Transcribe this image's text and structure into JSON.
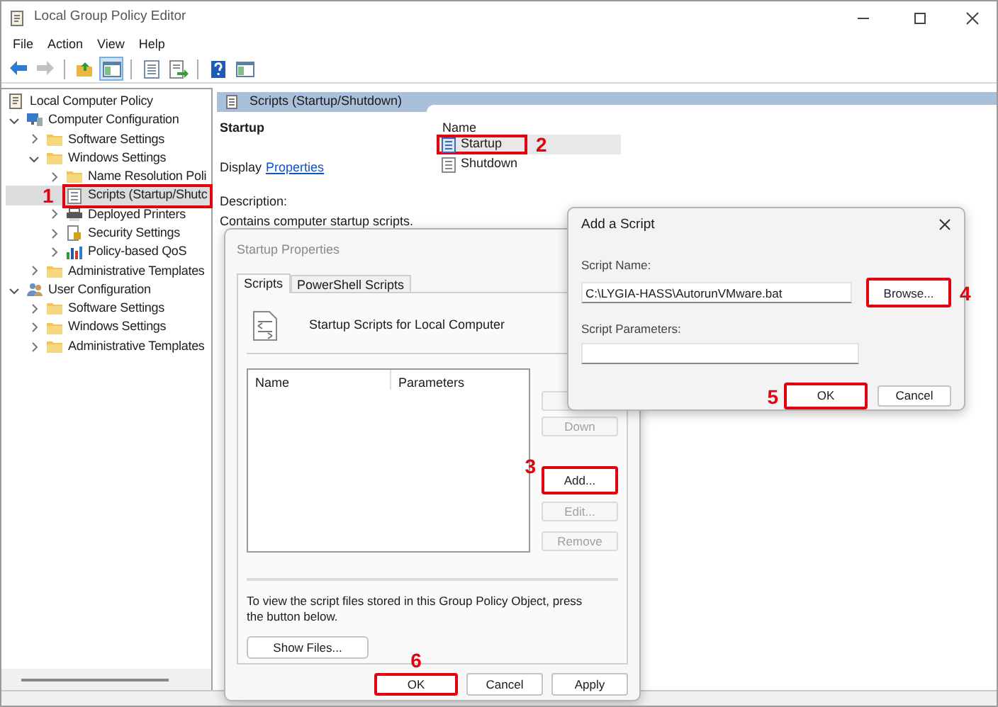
{
  "window": {
    "title": "Local Group Policy Editor"
  },
  "menu": [
    "File",
    "Action",
    "View",
    "Help"
  ],
  "toolbar": [
    {
      "kind": "back",
      "disabled": false,
      "selected": false
    },
    {
      "kind": "forward",
      "disabled": true,
      "selected": false
    },
    {
      "kind": "separator"
    },
    {
      "kind": "folder-up",
      "disabled": false,
      "selected": false
    },
    {
      "kind": "pane",
      "disabled": false,
      "selected": true
    },
    {
      "kind": "separator"
    },
    {
      "kind": "list",
      "disabled": false,
      "selected": false
    },
    {
      "kind": "export",
      "disabled": false,
      "selected": false
    },
    {
      "kind": "separator"
    },
    {
      "kind": "help",
      "disabled": false,
      "selected": false
    },
    {
      "kind": "pane",
      "disabled": false,
      "selected": false
    }
  ],
  "tree": [
    {
      "label": "Local Computer Policy",
      "kind": "policy",
      "selected": false,
      "children": [
        {
          "label": "Computer Configuration",
          "kind": "computer",
          "expanded": true,
          "selected": false,
          "children": [
            {
              "label": "Software Settings",
              "kind": "folder",
              "expanded": false,
              "selected": false
            },
            {
              "label": "Windows Settings",
              "kind": "folder",
              "expanded": true,
              "selected": false,
              "children": [
                {
                  "label": "Name Resolution Poli",
                  "kind": "folder",
                  "expanded": false,
                  "selected": false
                },
                {
                  "label": "Scripts (Startup/Shutc",
                  "kind": "scripts",
                  "selected": true,
                  "callout": "1"
                },
                {
                  "label": "Deployed Printers",
                  "kind": "printer",
                  "expanded": false,
                  "selected": false
                },
                {
                  "label": "Security Settings",
                  "kind": "security",
                  "expanded": false,
                  "selected": false
                },
                {
                  "label": "Policy-based QoS",
                  "kind": "qos",
                  "expanded": false,
                  "selected": false
                }
              ]
            },
            {
              "label": "Administrative Templates",
              "kind": "folder",
              "expanded": false,
              "selected": false
            }
          ]
        },
        {
          "label": "User Configuration",
          "kind": "user",
          "expanded": true,
          "selected": false,
          "children": [
            {
              "label": "Software Settings",
              "kind": "folder",
              "expanded": false,
              "selected": false
            },
            {
              "label": "Windows Settings",
              "kind": "folder",
              "expanded": false,
              "selected": false
            },
            {
              "label": "Administrative Templates",
              "kind": "folder",
              "expanded": false,
              "selected": false
            }
          ]
        }
      ]
    }
  ],
  "panel": {
    "title": "Scripts (Startup/Shutdown)",
    "heading": "Startup",
    "display_prefix": "Display",
    "display_link": "Properties",
    "description_label": "Description:",
    "description": "Contains computer startup scripts.",
    "list_column": "Name",
    "list_items": [
      {
        "label": "Startup",
        "kind": "startup",
        "selected": true,
        "callout": "2"
      },
      {
        "label": "Shutdown",
        "kind": "shutdown",
        "selected": false
      }
    ]
  },
  "properties_dialog": {
    "title": "Startup Properties",
    "active": false,
    "tabs": [
      {
        "label": "Scripts",
        "selected": true
      },
      {
        "label": "PowerShell Scripts",
        "selected": false
      }
    ],
    "heading": "Startup Scripts for Local Computer",
    "columns": [
      "Name",
      "Parameters"
    ],
    "side_buttons": [
      {
        "disabled": true
      },
      {
        "label": "Down",
        "disabled": true
      },
      {
        "label": "Add...",
        "disabled": false,
        "callout": "3"
      },
      {
        "label": "Edit...",
        "disabled": true
      },
      {
        "label": "Remove",
        "disabled": true
      }
    ],
    "note": "To view the script files stored in this Group Policy Object, press the button below.",
    "show_files": "Show Files...",
    "buttons": [
      {
        "label": "OK",
        "callout": "6"
      },
      {
        "label": "Cancel"
      },
      {
        "label": "Apply"
      }
    ]
  },
  "add_script_dialog": {
    "title": "Add a Script",
    "name_label": "Script Name:",
    "name_value": "C:\\LYGIA-HASS\\AutorunVMware.bat",
    "browse": {
      "label": "Browse...",
      "callout": "4"
    },
    "params_label": "Script Parameters:",
    "buttons": [
      {
        "label": "OK",
        "callout": "5"
      },
      {
        "label": "Cancel"
      }
    ]
  }
}
